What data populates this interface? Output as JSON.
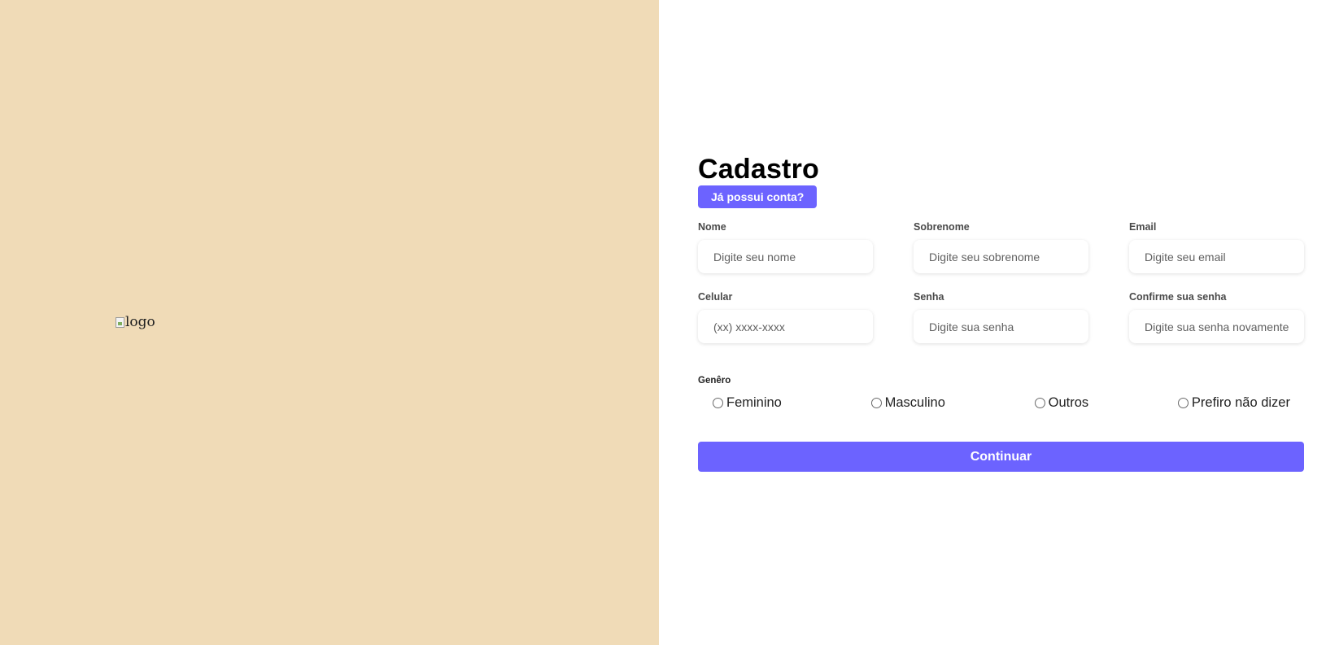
{
  "colors": {
    "left_panel_bg": "#f0dbb7",
    "accent": "#6c63ff"
  },
  "left_panel": {
    "logo_alt": "logo"
  },
  "form": {
    "title": "Cadastro",
    "login_link_label": "Já possui conta?",
    "fields": [
      {
        "label": "Nome",
        "placeholder": "Digite seu nome"
      },
      {
        "label": "Sobrenome",
        "placeholder": "Digite seu sobrenome"
      },
      {
        "label": "Email",
        "placeholder": "Digite seu email"
      },
      {
        "label": "Celular",
        "placeholder": "(xx) xxxx-xxxx"
      },
      {
        "label": "Senha",
        "placeholder": "Digite sua senha"
      },
      {
        "label": "Confirme sua senha",
        "placeholder": "Digite sua senha novamente"
      }
    ],
    "gender": {
      "title": "Genêro",
      "options": [
        "Feminino",
        "Masculino",
        "Outros",
        "Prefiro não dizer"
      ]
    },
    "submit_label": "Continuar"
  }
}
